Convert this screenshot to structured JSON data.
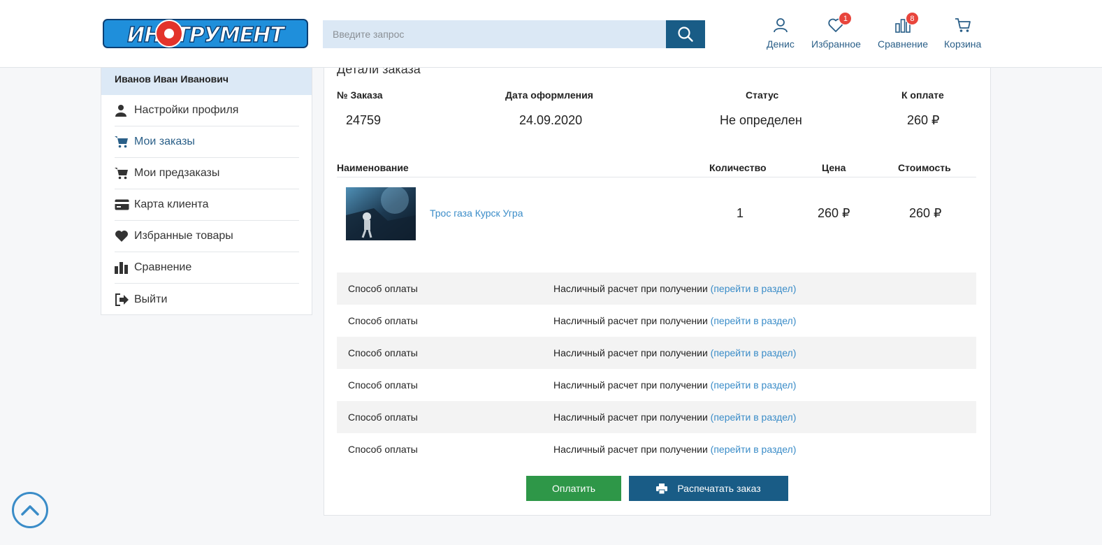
{
  "header": {
    "logo_text": "ИНСТРУМЕНТ",
    "search_placeholder": "Введите запрос",
    "nav": {
      "account_label": "Денис",
      "favorites_label": "Избранное",
      "favorites_count": "1",
      "compare_label": "Сравнение",
      "compare_count": "8",
      "cart_label": "Корзина"
    }
  },
  "sidebar": {
    "user_name": "Иванов Иван Иванович",
    "items": [
      {
        "label": "Настройки профиля",
        "icon": "user-icon"
      },
      {
        "label": "Мои заказы",
        "icon": "cart-icon",
        "active": true
      },
      {
        "label": "Мои предзаказы",
        "icon": "cart-icon"
      },
      {
        "label": "Карта клиента",
        "icon": "card-icon"
      },
      {
        "label": "Избранные товары",
        "icon": "heart-icon"
      },
      {
        "label": "Сравнение",
        "icon": "bars-icon"
      },
      {
        "label": "Выйти",
        "icon": "logout-icon"
      }
    ]
  },
  "order": {
    "title": "Детали заказа",
    "headers": {
      "number": "№ Заказа",
      "date": "Дата оформления",
      "status": "Статус",
      "to_pay": "К оплате"
    },
    "number": "24759",
    "date": "24.09.2020",
    "status": "Не определен",
    "to_pay": "260 ₽"
  },
  "items_table": {
    "headers": {
      "name": "Наименование",
      "quantity": "Количество",
      "price": "Цена",
      "cost": "Стоимость"
    },
    "rows": [
      {
        "name": "Трос газа Курск Угра",
        "quantity": "1",
        "price": "260 ₽",
        "cost": "260 ₽"
      }
    ]
  },
  "payment_rows": [
    {
      "key": "Способ оплаты",
      "value": "Насличный расчет при получении",
      "link": "(перейти в раздел)"
    },
    {
      "key": "Способ оплаты",
      "value": "Насличный расчет при получении",
      "link": "(перейти в раздел)"
    },
    {
      "key": "Способ оплаты",
      "value": "Насличный расчет при получении",
      "link": "(перейти в раздел)"
    },
    {
      "key": "Способ оплаты",
      "value": "Насличный расчет при получении",
      "link": "(перейти в раздел)"
    },
    {
      "key": "Способ оплаты",
      "value": "Насличный расчет при получении",
      "link": "(перейти в раздел)"
    },
    {
      "key": "Способ оплаты",
      "value": "Насличный расчет при получении",
      "link": "(перейти в раздел)"
    }
  ],
  "buttons": {
    "pay": "Оплатить",
    "print": "Распечатать заказ"
  },
  "colors": {
    "brand_blue": "#195c86",
    "pay_green": "#2e9748",
    "link_blue": "#3a8cc8",
    "badge_red": "#e8453c",
    "logo_red": "#e3332b",
    "logo_blue": "#1f8fdb"
  }
}
